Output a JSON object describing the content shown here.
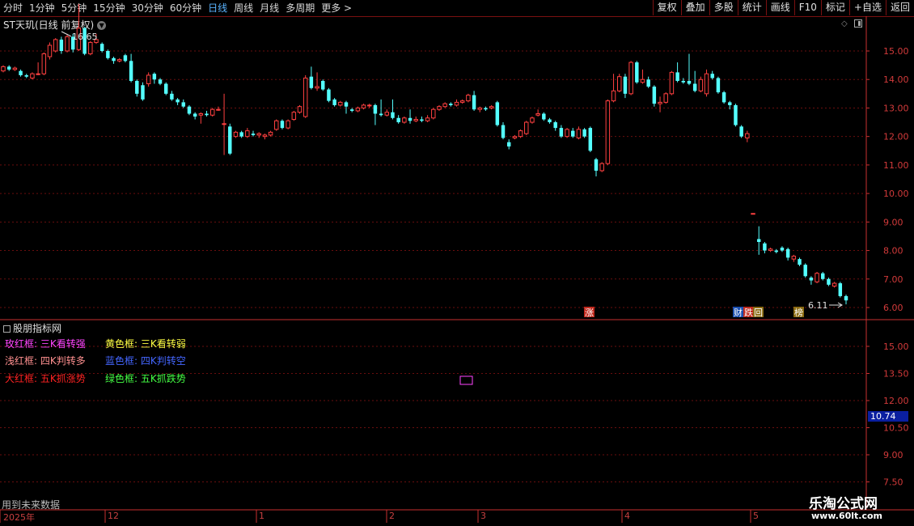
{
  "toolbar": {
    "periods": [
      "分时",
      "1分钟",
      "5分钟",
      "15分钟",
      "30分钟",
      "60分钟",
      "日线",
      "周线",
      "月线",
      "多周期",
      "更多 >"
    ],
    "active_period": "日线",
    "buttons": [
      "复权",
      "叠加",
      "多股",
      "统计",
      "画线",
      "F10",
      "标记",
      "+自选",
      "返回"
    ]
  },
  "chart_header": {
    "stock": "ST天玑(日线 前复权)"
  },
  "main_axis": {
    "ticks": [
      "15.00",
      "14.00",
      "13.00",
      "12.00",
      "11.00",
      "10.00",
      "9.00",
      "8.00",
      "7.00",
      "6.00"
    ]
  },
  "annotations": {
    "high_label": "16.65",
    "low_label": "6.11",
    "markers": [
      "涨",
      "财",
      "跌",
      "回",
      "榜"
    ]
  },
  "indicator": {
    "title": "股朋指标网",
    "axis_ticks": [
      "15.00",
      "13.50",
      "12.00",
      "10.50",
      "9.00",
      "7.50"
    ],
    "current_value": "10.74",
    "legend": [
      {
        "label": "玫红框: 三K看转强",
        "color": "#ff44ff"
      },
      {
        "label": "黄色框: 三K看转弱",
        "color": "#ffff44"
      },
      {
        "label": "浅红框: 四K判转多",
        "color": "#ff9090"
      },
      {
        "label": "蓝色框: 四K判转空",
        "color": "#4466ff"
      },
      {
        "label": "大红框: 五K抓涨势",
        "color": "#ff2222"
      },
      {
        "label": "绿色框: 五K抓跌势",
        "color": "#44ff44"
      }
    ],
    "future_note": "用到未来数据"
  },
  "x_axis": {
    "labels": [
      "2025年",
      "12",
      "1",
      "2",
      "3",
      "4",
      "5"
    ]
  },
  "watermark": {
    "title": "乐淘公式网",
    "url": "www.60lt.com"
  },
  "colors": {
    "up": "#ff4040",
    "down": "#54ffff",
    "grid": "#6a0e0e",
    "axis": "#c83030"
  },
  "chart_data": {
    "type": "candlestick",
    "ylim": [
      5.9,
      16.0
    ],
    "candles": [
      [
        14.3,
        14.45,
        14.5,
        14.25
      ],
      [
        14.45,
        14.35,
        14.5,
        14.3
      ],
      [
        14.35,
        14.4,
        14.45,
        14.3
      ],
      [
        14.3,
        14.15,
        14.35,
        14.1
      ],
      [
        14.15,
        14.1,
        14.2,
        14.05
      ],
      [
        14.05,
        14.2,
        14.25,
        14.0
      ],
      [
        14.2,
        14.2,
        14.6,
        14.15
      ],
      [
        14.2,
        14.9,
        14.95,
        14.15
      ],
      [
        14.8,
        15.2,
        15.3,
        14.7
      ],
      [
        15.0,
        15.4,
        15.45,
        14.95
      ],
      [
        15.4,
        15.0,
        15.5,
        14.9
      ],
      [
        15.0,
        15.5,
        15.6,
        14.95
      ],
      [
        15.5,
        15.05,
        15.6,
        14.95
      ],
      [
        15.05,
        15.8,
        16.65,
        15.0
      ],
      [
        15.8,
        14.9,
        15.85,
        14.85
      ],
      [
        14.9,
        15.3,
        15.35,
        14.85
      ],
      [
        15.3,
        15.4,
        15.6,
        15.25
      ],
      [
        15.25,
        15.0,
        15.3,
        14.95
      ],
      [
        15.0,
        14.75,
        15.05,
        14.7
      ],
      [
        14.75,
        14.65,
        14.8,
        14.55
      ],
      [
        14.65,
        14.7,
        14.75,
        14.6
      ],
      [
        14.85,
        14.65,
        14.9,
        14.6
      ],
      [
        14.65,
        13.95,
        14.9,
        13.9
      ],
      [
        13.95,
        13.5,
        14.0,
        13.4
      ],
      [
        13.8,
        13.3,
        13.9,
        13.25
      ],
      [
        13.85,
        14.15,
        14.25,
        13.75
      ],
      [
        14.2,
        14.0,
        14.25,
        13.85
      ],
      [
        14.0,
        13.85,
        14.05,
        13.8
      ],
      [
        13.85,
        13.5,
        13.9,
        13.45
      ],
      [
        13.5,
        13.3,
        13.6,
        13.25
      ],
      [
        13.3,
        13.2,
        13.35,
        13.1
      ],
      [
        13.2,
        13.05,
        13.3,
        13.0
      ],
      [
        13.05,
        12.8,
        13.1,
        12.75
      ],
      [
        12.8,
        12.7,
        12.85,
        12.6
      ],
      [
        12.75,
        12.8,
        12.85,
        12.45
      ],
      [
        12.8,
        12.75,
        12.9,
        12.7
      ],
      [
        12.75,
        12.95,
        13.0,
        12.7
      ],
      [
        12.95,
        12.95,
        13.05,
        12.9
      ],
      [
        12.45,
        12.45,
        13.5,
        11.35
      ],
      [
        12.35,
        11.4,
        12.45,
        11.35
      ],
      [
        12.0,
        12.15,
        12.2,
        11.95
      ],
      [
        12.15,
        12.0,
        12.2,
        11.95
      ],
      [
        12.0,
        12.2,
        12.3,
        11.95
      ],
      [
        12.1,
        12.05,
        12.2,
        12.0
      ],
      [
        12.05,
        12.1,
        12.15,
        11.95
      ],
      [
        12.0,
        12.05,
        12.1,
        11.9
      ],
      [
        12.05,
        12.15,
        12.2,
        12.0
      ],
      [
        12.25,
        12.55,
        12.6,
        12.2
      ],
      [
        12.55,
        12.3,
        12.6,
        12.25
      ],
      [
        12.3,
        12.55,
        12.6,
        12.25
      ],
      [
        12.6,
        12.85,
        12.9,
        12.55
      ],
      [
        12.85,
        13.05,
        13.1,
        12.8
      ],
      [
        12.7,
        14.05,
        14.15,
        12.65
      ],
      [
        14.1,
        13.7,
        14.45,
        13.65
      ],
      [
        13.7,
        13.75,
        14.25,
        13.6
      ],
      [
        13.95,
        13.65,
        14.0,
        13.6
      ],
      [
        13.65,
        13.25,
        13.7,
        13.2
      ],
      [
        13.3,
        13.1,
        13.35,
        13.05
      ],
      [
        13.1,
        13.2,
        13.25,
        13.05
      ],
      [
        13.2,
        13.05,
        13.25,
        12.8
      ],
      [
        12.95,
        12.9,
        13.0,
        12.85
      ],
      [
        12.9,
        13.0,
        13.05,
        12.85
      ],
      [
        13.0,
        13.1,
        13.15,
        12.95
      ],
      [
        13.1,
        13.1,
        13.15,
        13.0
      ],
      [
        13.1,
        12.8,
        13.15,
        12.4
      ],
      [
        12.8,
        12.75,
        13.3,
        12.7
      ],
      [
        12.75,
        12.85,
        12.95,
        12.7
      ],
      [
        12.85,
        12.65,
        13.3,
        12.6
      ],
      [
        12.65,
        12.5,
        12.75,
        12.45
      ],
      [
        12.5,
        12.65,
        12.7,
        12.45
      ],
      [
        12.65,
        12.55,
        12.95,
        12.45
      ],
      [
        12.55,
        12.6,
        12.7,
        12.5
      ],
      [
        12.6,
        12.55,
        12.7,
        12.5
      ],
      [
        12.55,
        12.65,
        12.75,
        12.5
      ],
      [
        12.65,
        12.95,
        13.0,
        12.6
      ],
      [
        12.95,
        13.05,
        13.1,
        12.9
      ],
      [
        13.05,
        13.15,
        13.2,
        13.0
      ],
      [
        13.15,
        13.1,
        13.2,
        13.05
      ],
      [
        13.1,
        13.2,
        13.3,
        13.05
      ],
      [
        13.2,
        13.25,
        13.3,
        13.15
      ],
      [
        13.25,
        13.45,
        13.5,
        13.2
      ],
      [
        13.45,
        12.95,
        13.6,
        12.9
      ],
      [
        12.95,
        13.0,
        13.05,
        12.85
      ],
      [
        13.0,
        12.95,
        13.05,
        12.9
      ],
      [
        13.0,
        13.05,
        13.1,
        12.95
      ],
      [
        13.2,
        12.4,
        13.25,
        12.35
      ],
      [
        12.4,
        11.95,
        12.5,
        11.9
      ],
      [
        11.8,
        11.65,
        11.9,
        11.55
      ],
      [
        11.95,
        12.0,
        12.05,
        11.9
      ],
      [
        12.0,
        12.2,
        12.25,
        11.95
      ],
      [
        12.1,
        12.5,
        12.55,
        12.05
      ],
      [
        12.5,
        12.65,
        12.7,
        12.45
      ],
      [
        12.75,
        12.8,
        12.95,
        12.7
      ],
      [
        12.8,
        12.6,
        12.85,
        12.55
      ],
      [
        12.6,
        12.5,
        12.65,
        12.45
      ],
      [
        12.5,
        12.3,
        12.55,
        12.2
      ],
      [
        12.3,
        12.0,
        12.4,
        11.95
      ],
      [
        12.0,
        12.25,
        12.3,
        11.95
      ],
      [
        12.2,
        12.0,
        12.3,
        11.95
      ],
      [
        11.95,
        12.25,
        12.35,
        11.9
      ],
      [
        12.25,
        12.0,
        12.3,
        11.95
      ],
      [
        12.3,
        11.5,
        12.35,
        11.45
      ],
      [
        11.2,
        10.8,
        11.25,
        10.6
      ],
      [
        10.8,
        11.05,
        11.1,
        10.75
      ],
      [
        11.05,
        13.25,
        13.3,
        11.0
      ],
      [
        13.25,
        13.6,
        14.2,
        13.2
      ],
      [
        13.6,
        14.1,
        14.2,
        13.55
      ],
      [
        14.1,
        13.5,
        14.2,
        13.35
      ],
      [
        13.5,
        14.6,
        14.65,
        13.45
      ],
      [
        14.6,
        13.9,
        14.65,
        13.85
      ],
      [
        13.9,
        14.0,
        14.35,
        13.85
      ],
      [
        14.0,
        13.75,
        14.1,
        13.7
      ],
      [
        13.75,
        13.15,
        13.8,
        13.05
      ],
      [
        13.15,
        13.2,
        13.4,
        12.85
      ],
      [
        13.2,
        13.5,
        13.55,
        13.15
      ],
      [
        13.5,
        14.25,
        14.3,
        13.45
      ],
      [
        14.25,
        13.95,
        14.6,
        13.9
      ],
      [
        13.95,
        13.9,
        14.05,
        13.85
      ],
      [
        13.95,
        13.85,
        14.9,
        13.8
      ],
      [
        13.85,
        13.6,
        14.3,
        13.55
      ],
      [
        13.6,
        14.0,
        14.1,
        13.55
      ],
      [
        13.5,
        14.2,
        14.35,
        13.4
      ],
      [
        14.2,
        14.05,
        14.3,
        14.0
      ],
      [
        14.05,
        13.55,
        14.1,
        13.5
      ],
      [
        13.55,
        13.2,
        13.6,
        13.15
      ],
      [
        13.2,
        13.1,
        13.25,
        12.95
      ],
      [
        13.1,
        12.4,
        13.15,
        12.35
      ],
      [
        12.35,
        12.0,
        12.4,
        11.95
      ],
      [
        11.95,
        12.1,
        12.2,
        11.8
      ],
      [
        9.3,
        9.3,
        9.3,
        9.3
      ],
      [
        8.4,
        8.3,
        8.85,
        7.85
      ],
      [
        8.25,
        8.0,
        8.3,
        7.9
      ],
      [
        8.0,
        8.05,
        8.1,
        7.95
      ],
      [
        8.0,
        7.95,
        8.05,
        7.9
      ],
      [
        8.1,
        8.0,
        8.15,
        7.95
      ],
      [
        8.05,
        7.75,
        8.1,
        7.65
      ],
      [
        7.7,
        7.8,
        7.85,
        7.6
      ],
      [
        7.7,
        7.5,
        7.75,
        7.45
      ],
      [
        7.5,
        7.1,
        7.55,
        7.05
      ],
      [
        7.05,
        6.95,
        7.1,
        6.8
      ],
      [
        6.9,
        7.2,
        7.25,
        6.85
      ],
      [
        7.2,
        7.0,
        7.25,
        6.95
      ],
      [
        7.0,
        6.8,
        7.05,
        6.75
      ],
      [
        6.75,
        6.85,
        6.9,
        6.7
      ],
      [
        6.85,
        6.4,
        6.9,
        6.35
      ],
      [
        6.4,
        6.25,
        6.45,
        6.11
      ]
    ]
  }
}
